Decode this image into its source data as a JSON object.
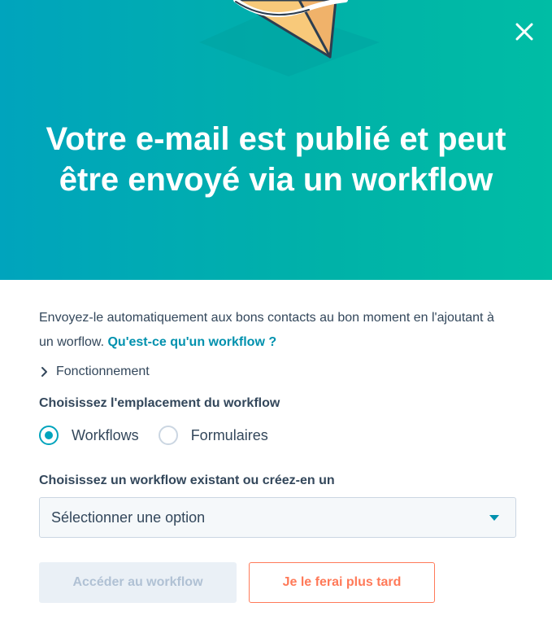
{
  "modal": {
    "title": "Votre e-mail est publié et peut être envoyé via un workflow",
    "close_icon": "close-icon",
    "illustration_icon": "envelope-illustration-icon",
    "colors": {
      "hero_start": "#00a4bd",
      "hero_end": "#00bda5",
      "link": "#0091ae",
      "accent_orange": "#ff7a59"
    }
  },
  "content": {
    "description": "Envoyez-le automatiquement aux bons contacts au bon moment en l'ajoutant à un worflow. ",
    "link_text": "Qu'est-ce qu'un workflow ?",
    "how_it_works": "Fonctionnement",
    "location_label": "Choisissez l'emplacement du workflow",
    "radio_options": [
      "Workflows",
      "Formulaires"
    ],
    "selected_option": "Workflows",
    "select_label": "Choisissez un workflow existant ou créez-en un",
    "select_placeholder": "Sélectionner une option"
  },
  "buttons": {
    "primary": "Accéder au workflow",
    "secondary": "Je le ferai plus tard"
  }
}
